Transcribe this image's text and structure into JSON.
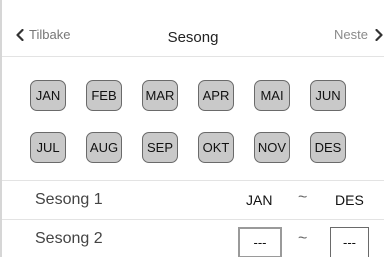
{
  "header": {
    "back_label": "Tilbake",
    "title": "Sesong",
    "next_label": "Neste"
  },
  "months": [
    "JAN",
    "FEB",
    "MAR",
    "APR",
    "MAI",
    "JUN",
    "JUL",
    "AUG",
    "SEP",
    "OKT",
    "NOV",
    "DES"
  ],
  "seasons": [
    {
      "label": "Sesong 1",
      "from": "JAN",
      "separator": "~",
      "to": "DES"
    },
    {
      "label": "Sesong 2",
      "from": "---",
      "separator": "~",
      "to": "---"
    }
  ],
  "colors": {
    "month_button_bg": "#c9c9c9",
    "month_button_border": "#6a6a6a",
    "nav_text": "#777777"
  }
}
